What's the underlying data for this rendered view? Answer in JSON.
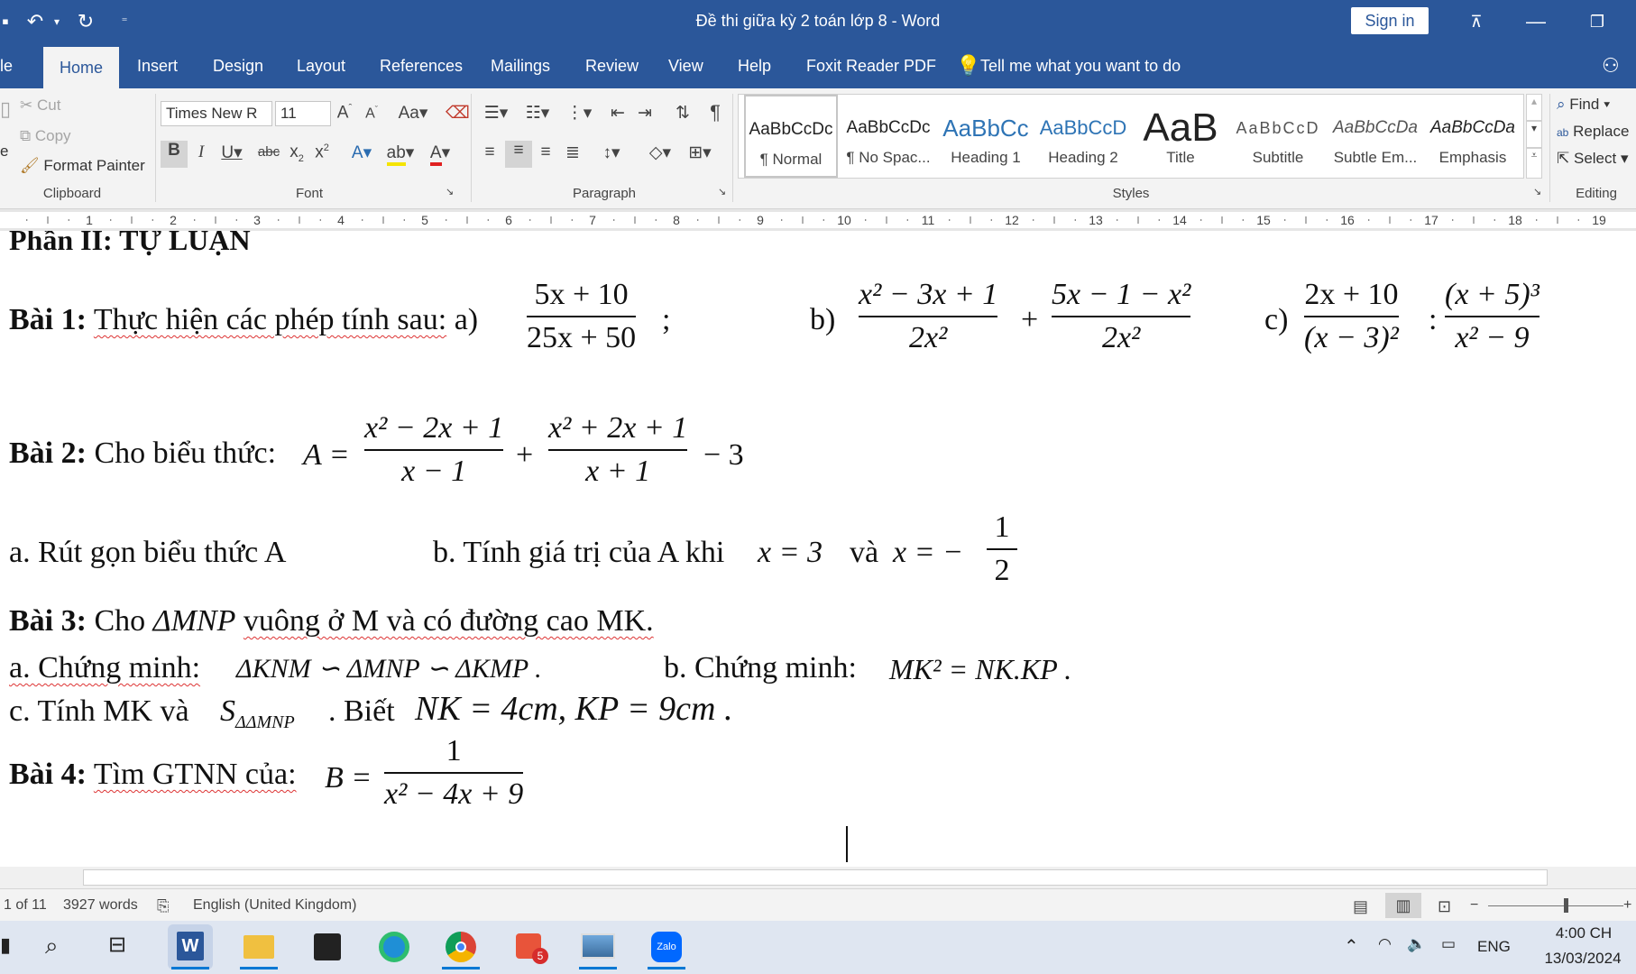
{
  "titlebar": {
    "title": "Đề thi giữa kỳ 2 toán lớp 8  -  Word",
    "sign_in": "Sign in"
  },
  "tabs": [
    "le",
    "Home",
    "Insert",
    "Design",
    "Layout",
    "References",
    "Mailings",
    "Review",
    "View",
    "Help",
    "Foxit Reader PDF"
  ],
  "tell_me": "Tell me what you want to do",
  "clipboard": {
    "cut": "Cut",
    "copy": "Copy",
    "format_painter": "Format Painter",
    "label": "Clipboard"
  },
  "font": {
    "name": "Times New R",
    "size": "11",
    "label": "Font"
  },
  "paragraph": {
    "label": "Paragraph"
  },
  "styles": {
    "label": "Styles",
    "items": [
      {
        "sample": "AaBbCcDc",
        "name": "¶ Normal"
      },
      {
        "sample": "AaBbCcDc",
        "name": "¶ No Spac..."
      },
      {
        "sample": "AaBbCc",
        "name": "Heading 1"
      },
      {
        "sample": "AaBbCcD",
        "name": "Heading 2"
      },
      {
        "sample": "AaB",
        "name": "Title"
      },
      {
        "sample": "AaBbCcD",
        "name": "Subtitle"
      },
      {
        "sample": "AaBbCcDa",
        "name": "Subtle Em..."
      },
      {
        "sample": "AaBbCcDa",
        "name": "Emphasis"
      }
    ]
  },
  "editing": {
    "find": "Find",
    "replace": "Replace",
    "select": "Select",
    "label": "Editing"
  },
  "ruler": [
    "1",
    "2",
    "3",
    "4",
    "5",
    "6",
    "7",
    "8",
    "9",
    "10",
    "11",
    "12",
    "13",
    "14",
    "15",
    "16",
    "17",
    "18",
    "19"
  ],
  "document": {
    "heading": "Phần II: TỰ LUẬN",
    "bai1": {
      "label": "Bài 1:",
      "text": "Thực hiện các phép tính sau:",
      "a": "a)",
      "b": "b)",
      "c": "c)",
      "fa_num": "5x + 10",
      "fa_den": "25x + 50",
      "fb1_num": "x² − 3x + 1",
      "fb1_den": "2x²",
      "fb2_num": "5x − 1 − x²",
      "fb2_den": "2x²",
      "fc1_num": "2x + 10",
      "fc1_den": "(x − 3)²",
      "fc2_num": "(x + 5)³",
      "fc2_den": "x² − 9"
    },
    "bai2": {
      "label": "Bài 2:",
      "text": "Cho biểu thức:",
      "a_eq": "A =",
      "f1_num": "x² − 2x + 1",
      "f1_den": "x − 1",
      "f2_num": "x² + 2x + 1",
      "f2_den": "x + 1",
      "tail": "− 3",
      "part_a": "a.  Rút gọn biểu thức A",
      "part_b": "b. Tính giá trị của A khi",
      "x3": "x = 3",
      "va": "và",
      "x_half": "x = −",
      "half_num": "1",
      "half_den": "2"
    },
    "bai3": {
      "label": "Bài 3:",
      "text1": "Cho",
      "triangle": "ΔMNP",
      "text2": "vuông ở M và có đường cao MK.",
      "a_label": "a. Chứng minh:",
      "a_math": "ΔKNM ∽ ΔMNP ∽ ΔKMP .",
      "b_label": "b. Chứng minh:",
      "b_math": "MK² = NK.KP .",
      "c_label": "c. Tính MK và",
      "c_s": "S",
      "c_sub": "ΔΔMNP",
      "c_text": ". Biết",
      "c_math": "NK = 4cm, KP = 9cm ."
    },
    "bai4": {
      "label": "Bài 4:",
      "text": "Tìm GTNN của:",
      "b_eq": "B =",
      "f_num": "1",
      "f_den": "x² − 4x + 9"
    }
  },
  "status": {
    "page": "1 of 11",
    "words": "3927 words",
    "language": "English (United Kingdom)"
  },
  "taskbar": {
    "lang": "ENG",
    "time": "4:00 CH",
    "date": "13/03/2024",
    "badge": "5",
    "zalo": "Zalo"
  }
}
